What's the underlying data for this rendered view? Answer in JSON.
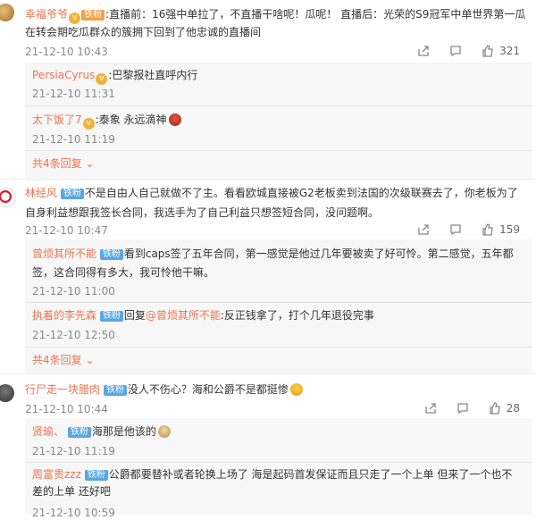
{
  "comments": [
    {
      "user": "幸福爷爷",
      "badge": "铁粉",
      "text": "直播前：16强中单拉了，不直播干啥呢！瓜呢！ 直播后：光荣的S9冠军中单世界第一瓜",
      "text2": "在转会期吃瓜群众的簇拥下回到了他忠诚的直播间",
      "time": "21-12-10 10:43",
      "likes": "321",
      "replies": [
        {
          "user": "PersiaCyrus",
          "text": "巴黎报社直呼内行",
          "time": "21-12-10 11:31"
        },
        {
          "user": "太下饭了7",
          "text": "泰象 永远滴神",
          "time": "21-12-10 11:19"
        }
      ],
      "more": "共4条回复"
    },
    {
      "user": "林经风",
      "badge": "铁粉",
      "text": "不是自由人自己就做不了主。看看欧城直接被G2老板卖到法国的次级联赛去了，你老板为了",
      "text2": "自身利益想跟我签长合同，我选手为了自己利益只想签短合同，没问题啊。",
      "time": "21-12-10 10:47",
      "likes": "159",
      "replies": [
        {
          "user": "曾烦其所不能",
          "badge": "铁粉",
          "text": "看到caps签了五年合同，第一感觉是他过几年要被卖了好可怜。第二感觉，五年都",
          "text2": "签，这合同得有多大，我可怜他干嘛。",
          "time": "21-12-10 11:00"
        },
        {
          "user": "执着的李先森",
          "badge": "铁粉",
          "text_prefix": "回复",
          "mention": "@曾烦其所不能",
          "text": ":反正钱拿了，打个几年退役完事",
          "time": "21-12-10 12:50"
        }
      ],
      "more": "共4条回复"
    },
    {
      "user": "行尸走一块腊肉",
      "badge": "铁粉",
      "text": "没人不伤心？海和公爵不是都挺惨",
      "time": "21-12-10 10:44",
      "likes": "28",
      "replies": [
        {
          "user": "贤瑜、",
          "badge": "铁粉",
          "text": "海那是他该的",
          "time": "21-12-10 11:19"
        },
        {
          "user": "周富贵zzz",
          "badge": "铁粉",
          "text": "公爵都要替补或者轮换上场了 海是起码首发保证而且只走了一个上单 但来了一个也不",
          "text2": "差的上单 还好吧",
          "time": "21-12-10 10:59"
        }
      ]
    }
  ],
  "colors": {
    "accent": "#eb7350",
    "fan_badge": "#58a7e6"
  }
}
